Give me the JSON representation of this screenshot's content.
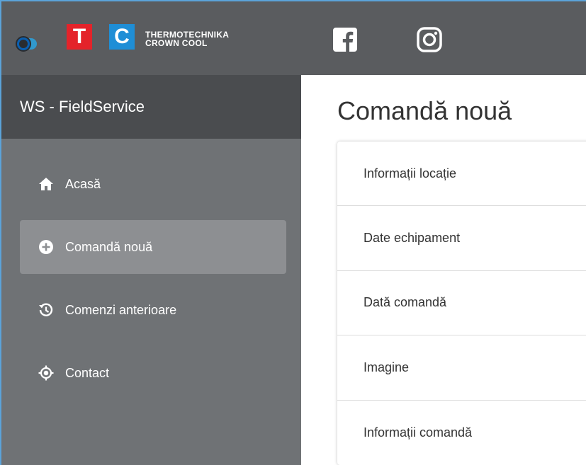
{
  "header": {
    "brand_line1": "THERMOTECHNIKA",
    "brand_line2": "CROWN COOL",
    "badge_t": "T",
    "badge_c": "C",
    "social": [
      {
        "icon": "facebook-icon"
      },
      {
        "icon": "instagram-icon"
      }
    ]
  },
  "sidebar": {
    "title": "WS - FieldService",
    "items": [
      {
        "label": "Acasă",
        "icon": "home-icon",
        "active": false
      },
      {
        "label": "Comandă nouă",
        "icon": "plus-circle-icon",
        "active": true
      },
      {
        "label": "Comenzi anterioare",
        "icon": "history-icon",
        "active": false
      },
      {
        "label": "Contact",
        "icon": "location-target-icon",
        "active": false
      }
    ]
  },
  "main": {
    "title": "Comandă nouă",
    "sections": [
      {
        "label": "Informații locație"
      },
      {
        "label": "Date echipament"
      },
      {
        "label": "Dată comandă"
      },
      {
        "label": "Imagine"
      },
      {
        "label": "Informații comandă"
      }
    ]
  },
  "colors": {
    "topbar": "#5a5c5f",
    "sidebar": "#6f7275",
    "sidebar_header": "#4a4c4f",
    "active_item": "#8d8f92",
    "brand_red": "#e4232a",
    "brand_blue": "#1f8ed6"
  }
}
